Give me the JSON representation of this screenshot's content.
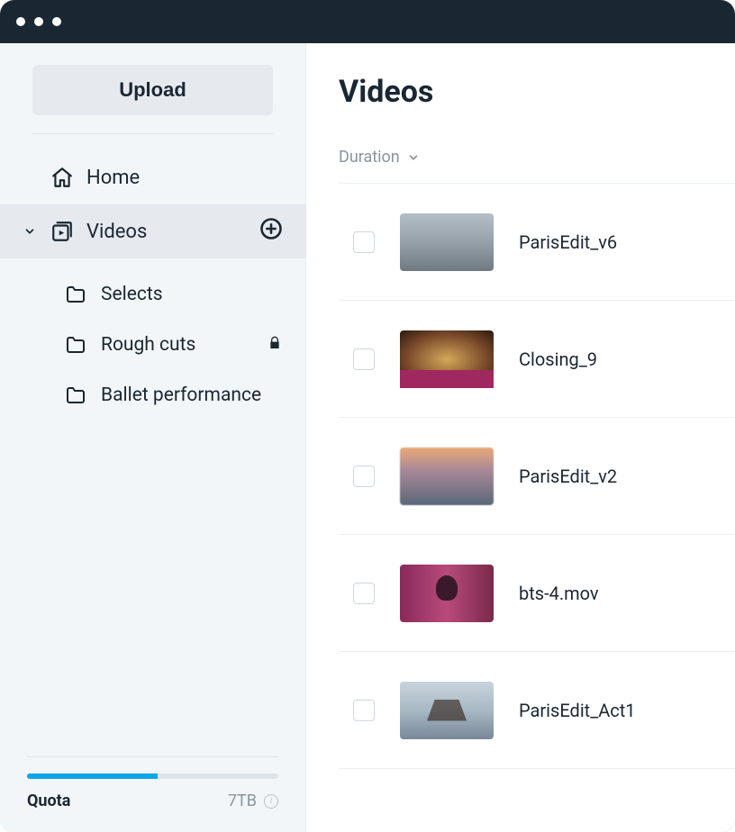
{
  "upload": {
    "label": "Upload"
  },
  "nav": {
    "home": "Home",
    "videos": "Videos",
    "subfolders": [
      {
        "label": "Selects",
        "locked": false
      },
      {
        "label": "Rough cuts",
        "locked": true
      },
      {
        "label": "Ballet performance",
        "locked": false
      }
    ]
  },
  "quota": {
    "label": "Quota",
    "value": "7TB",
    "percent": 52
  },
  "main": {
    "title": "Videos",
    "sort_label": "Duration",
    "videos": [
      {
        "name": "ParisEdit_v6",
        "thumb": "t1"
      },
      {
        "name": "Closing_9",
        "thumb": "t2"
      },
      {
        "name": "ParisEdit_v2",
        "thumb": "t3"
      },
      {
        "name": "bts-4.mov",
        "thumb": "t4"
      },
      {
        "name": "ParisEdit_Act1",
        "thumb": "t5"
      }
    ]
  }
}
